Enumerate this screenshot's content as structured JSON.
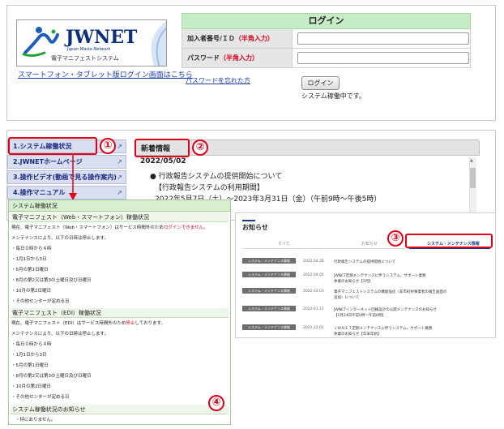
{
  "login": {
    "logo_text": "JWNET",
    "logo_sub": "Japan Waste Network",
    "logo_caption": "電子マニフェストシステム",
    "smartphone_link": "スマートフォン・タブレット版ログイン画面はこちら",
    "title": "ログイン",
    "user_id_label": "加入者番号/ＩＤ",
    "user_id_note": "（半角入力）",
    "user_id_value": "",
    "password_label": "パスワード",
    "password_note": "（半角入力）",
    "password_value": "",
    "forgot_link": "パスワードを忘れた方",
    "login_button": "ログイン",
    "status_text": "システム稼働中です。"
  },
  "side_menu": {
    "items": [
      {
        "label": "1.システム稼働状況"
      },
      {
        "label": "2.JWNETホームページ"
      },
      {
        "label": "3.操作ビデオ(動画で見る操作案内)"
      },
      {
        "label": "4.操作マニュアル"
      }
    ]
  },
  "news": {
    "title": "新着情報",
    "date": "2022/05/02",
    "item1": "行政報告システムの提供開始について",
    "item2": "【行政報告システムの利用期間】",
    "item3": "2022年5月7日（土）～2023年3月31日（金）（午前9時～午後5時）"
  },
  "markers": {
    "m1": "①",
    "m2": "②",
    "m3": "③",
    "m4": "④"
  },
  "status_popup": {
    "title": "システム稼働状況",
    "sec1_title": "電子マニフェスト（Web・スマートフォン）稼働状況",
    "sec1_line1_a": "現在、電子マニフェスト（Web・スマートフォン）はサービス時間外のため",
    "sec1_line1_b": "ログインできません。",
    "sec2_title": "電子マニフェスト（EDI）稼働状況",
    "sec2_line1_a": "現在、電子マニフェスト（EDI）はサービス時間外のため",
    "sec2_line1_b": "停止",
    "sec2_line1_c": "しております。",
    "maint_intro": "メンテナンスにより、以下の日時は停止します。",
    "schedule": [
      "毎日０時から４時",
      "1月1日から3日",
      "5月の第1日曜日",
      "8月の第2又は第3の土曜日及び日曜日",
      "10月の第2日曜日",
      "その他センターが定める日"
    ],
    "notice_title": "システム稼働状況のお知らせ",
    "notice_text": "特にありません。"
  },
  "notice_popup": {
    "title": "お知らせ",
    "tabs": [
      "すべて",
      "お知らせ",
      "システム・メンテナンス情報"
    ],
    "rows": [
      {
        "badge": "システム・メンテナンス情報",
        "date": "2022.04.28",
        "text1": "行政報告システムの提供開始について",
        "text2": ""
      },
      {
        "badge": "システム・メンテナンス情報",
        "date": "2022.04.05",
        "text1": "JWNET定期メンテナンスに伴うシステム、サポート業務",
        "text2": "休業のお知らせ【5月】"
      },
      {
        "badge": "システム・メンテナンス情報",
        "date": "2022.03.03",
        "text1": "電子マニフェストシステムの機能強化（非市町村事業者の報告画面の",
        "text2": "追加）について"
      },
      {
        "badge": "システム・メンテナンス情報",
        "date": "2022.01.11",
        "text1": "JWNETインターネット回線設計の公開メンテナンスのお知らせ",
        "text2": "【1月24日午前0時～午前8時】"
      },
      {
        "badge": "システム・メンテナンス情報",
        "date": "2021.12.01",
        "text1": "ＪＷＮＥＴ定期メンテナンスに伴うシステム、サポート業務",
        "text2": "休業のお知らせ【年末年始】"
      }
    ]
  },
  "colors": {
    "accent_red": "#e0001a",
    "link_blue": "#1a3fb0",
    "login_header": "#c6ecc6"
  }
}
